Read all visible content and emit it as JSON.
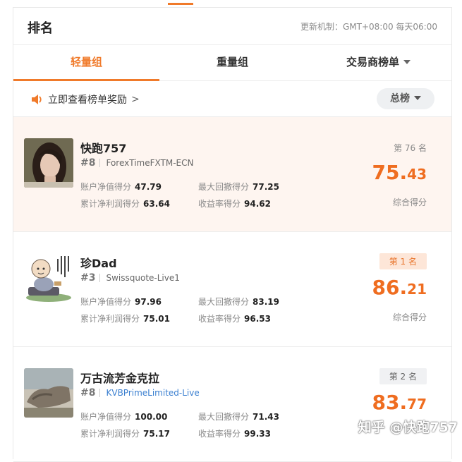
{
  "header": {
    "title": "排名",
    "update_text": "更新机制：GMT+08:00 每天06:00"
  },
  "tabs": [
    {
      "label": "轻量组",
      "active": true
    },
    {
      "label": "重量组",
      "active": false
    },
    {
      "label": "交易商榜单",
      "active": false
    }
  ],
  "reward": {
    "link_text": "立即查看榜单奖励",
    "arrow": ">"
  },
  "sort": {
    "label": "总榜"
  },
  "cards": [
    {
      "name": "快跑757",
      "rank_no": "#8",
      "broker": "ForexTimeFXTM-ECN",
      "stats": [
        {
          "label": "账户净值得分",
          "value": "47.79"
        },
        {
          "label": "最大回撤得分",
          "value": "77.25"
        },
        {
          "label": "累计净利润得分",
          "value": "63.64"
        },
        {
          "label": "收益率得分",
          "value": "94.62"
        }
      ],
      "place": "第 76 名",
      "score_int": "75.",
      "score_dec": "43",
      "score_label": "综合得分"
    },
    {
      "name": "珍Dad",
      "rank_no": "#3",
      "broker": "Swissquote-Live1",
      "stats": [
        {
          "label": "账户净值得分",
          "value": "97.96"
        },
        {
          "label": "最大回撤得分",
          "value": "83.19"
        },
        {
          "label": "累计净利润得分",
          "value": "75.01"
        },
        {
          "label": "收益率得分",
          "value": "96.53"
        }
      ],
      "place": "第 1 名",
      "score_int": "86.",
      "score_dec": "21",
      "score_label": "综合得分"
    },
    {
      "name": "万古流芳金克拉",
      "rank_no": "#8",
      "broker": "KVBPrimeLimited-Live",
      "stats": [
        {
          "label": "账户净值得分",
          "value": "100.00"
        },
        {
          "label": "最大回撤得分",
          "value": "71.43"
        },
        {
          "label": "累计净利润得分",
          "value": "75.17"
        },
        {
          "label": "收益率得分",
          "value": "99.33"
        }
      ],
      "place": "第 2 名",
      "score_int": "83.",
      "score_dec": "77"
    }
  ],
  "watermark": "知乎 @快跑757",
  "colors": {
    "accent": "#f07a2a",
    "score": "#ef6d20",
    "link": "#3a7fd0"
  }
}
